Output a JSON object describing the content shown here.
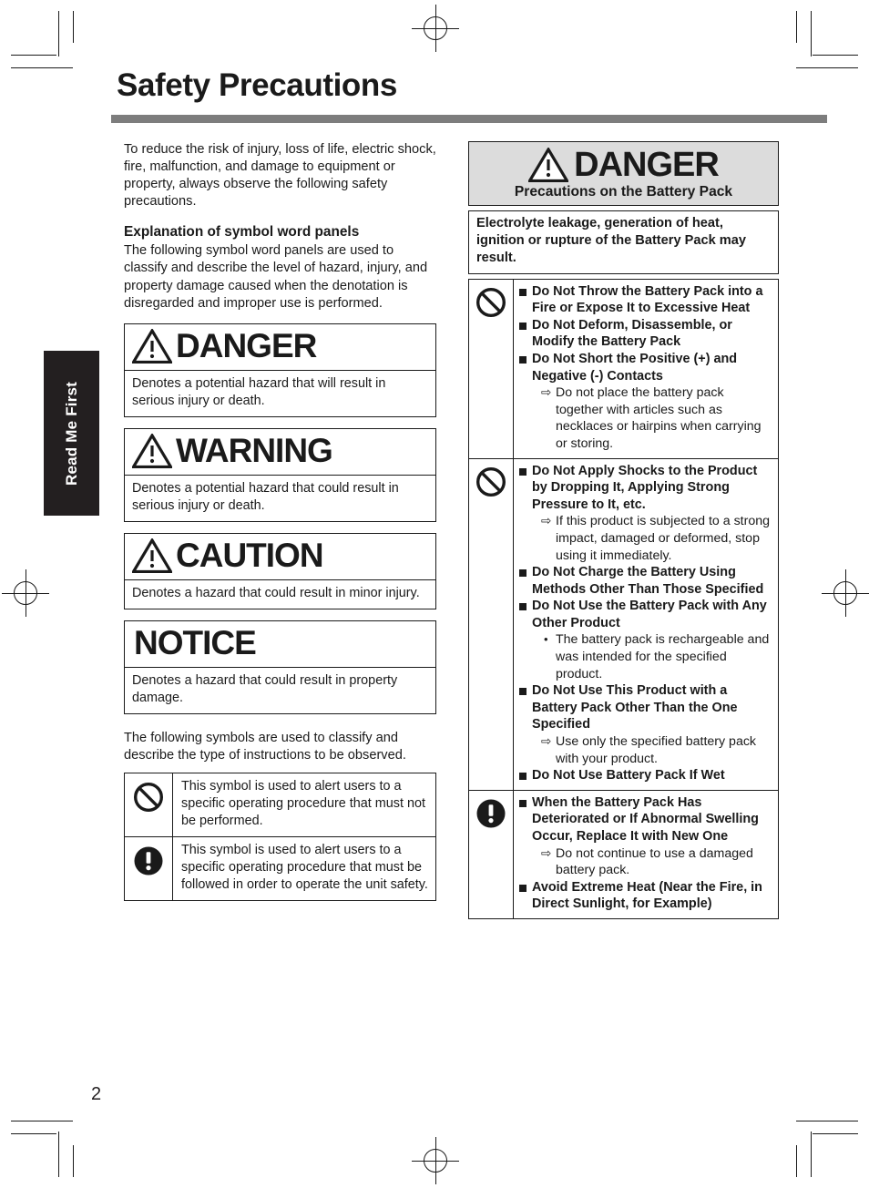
{
  "page": {
    "title": "Safety Precautions",
    "number": "2",
    "side_tab": "Read Me First"
  },
  "left_column": {
    "intro": "To reduce the risk of injury, loss of life, electric shock, fire, malfunction, and damage to equipment or property, always observe the following safety precautions.",
    "section_heading": "Explanation of symbol word panels",
    "section_intro": "The following symbol word panels are used to classify and describe the level of hazard, injury, and property damage caused when the denotation is disregarded and improper use is performed.",
    "word_panels": [
      {
        "icon": "warning-triangle-icon",
        "word": "DANGER",
        "description": "Denotes a potential hazard that will result in serious injury or death."
      },
      {
        "icon": "warning-triangle-icon",
        "word": "WARNING",
        "description": "Denotes a potential hazard that could result in serious injury or death."
      },
      {
        "icon": "warning-triangle-icon",
        "word": "CAUTION",
        "description": "Denotes a hazard that could result in minor injury."
      },
      {
        "icon": "none",
        "word": "NOTICE",
        "description": "Denotes a hazard that could result in property damage."
      }
    ],
    "symbols_intro": "The following symbols are used to classify and describe the type of instructions to be observed.",
    "symbol_rows": [
      {
        "icon": "prohibition-icon",
        "text": "This symbol is used to alert users to a specific operating procedure that must not be performed."
      },
      {
        "icon": "mandatory-exclamation-icon",
        "text": "This symbol is used to alert users to a specific operating procedure that must be followed in order to operate the unit safety."
      }
    ]
  },
  "right_column": {
    "danger_header": {
      "icon": "warning-triangle-icon",
      "word": "DANGER",
      "subtitle": "Precautions on the Battery Pack",
      "background_color": "#dcdcdc"
    },
    "lead_text": "Electrolyte leakage, generation of heat, ignition or rupture of the Battery Pack may result.",
    "rows": [
      {
        "icon": "prohibition-icon",
        "items": [
          {
            "text": "Do Not Throw the Battery Pack into a Fire or Expose It to Excessive Heat",
            "sub": []
          },
          {
            "text": "Do Not Deform, Disassemble, or Modify the Battery Pack",
            "sub": []
          },
          {
            "text": "Do Not Short the Positive (+) and Negative (-) Contacts",
            "sub": [
              {
                "marker": "arrow",
                "text": "Do not place the battery pack together with articles such as necklaces or hairpins when carrying or storing."
              }
            ]
          }
        ]
      },
      {
        "icon": "prohibition-icon",
        "items": [
          {
            "text": "Do Not Apply Shocks to the Product by Dropping It, Applying Strong Pressure to It, etc.",
            "sub": [
              {
                "marker": "arrow",
                "text": "If this product is subjected to a strong impact, damaged or deformed, stop using it immediately."
              }
            ]
          },
          {
            "text": "Do Not Charge the Battery Using Methods Other Than Those Specified",
            "sub": []
          },
          {
            "text": "Do Not Use the Battery Pack with Any Other Product",
            "sub": [
              {
                "marker": "dot",
                "text": "The battery pack is rechargeable and was intended for the specified product."
              }
            ]
          },
          {
            "text": "Do Not Use This Product with a Battery Pack Other Than the One Specified",
            "sub": [
              {
                "marker": "arrow",
                "text": "Use only the specified battery pack with your product."
              }
            ]
          },
          {
            "text": "Do Not Use Battery Pack If Wet",
            "sub": []
          }
        ]
      },
      {
        "icon": "mandatory-exclamation-icon",
        "items": [
          {
            "text": "When the Battery Pack Has Deteriorated or If Abnormal Swelling Occur, Replace It with New One",
            "sub": [
              {
                "marker": "arrow",
                "text": "Do not continue to use a damaged battery pack."
              }
            ]
          },
          {
            "text": "Avoid Extreme Heat (Near the Fire, in Direct Sunlight, for Example)",
            "sub": []
          }
        ]
      }
    ]
  }
}
